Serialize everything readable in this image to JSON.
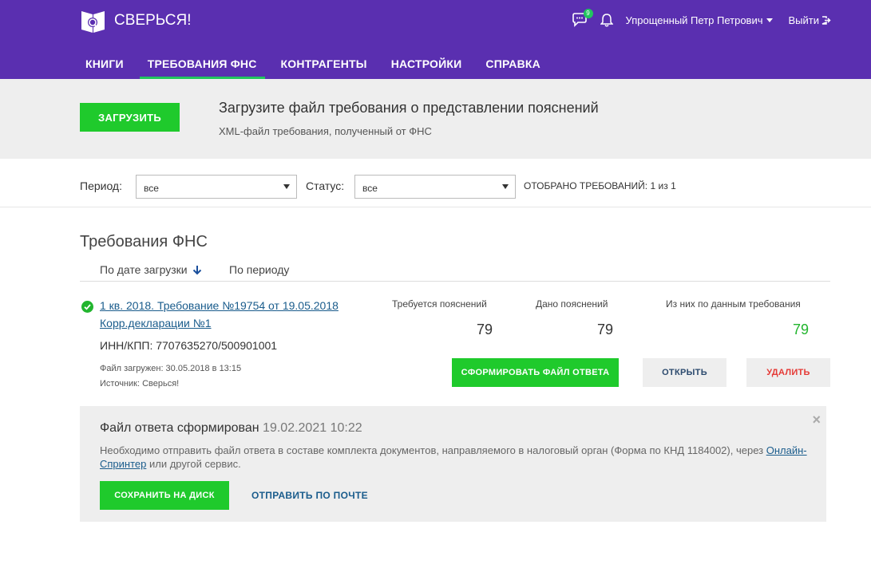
{
  "header": {
    "logo_text": "СВЕРЬСЯ!",
    "chat_badge": "9",
    "user_name": "Упрощенный Петр Петрович",
    "logout_label": "Выйти",
    "brand_color": "#5a2fb0"
  },
  "nav": {
    "items": [
      {
        "label": "КНИГИ",
        "active": false
      },
      {
        "label": "ТРЕБОВАНИЯ ФНС",
        "active": true
      },
      {
        "label": "КОНТРАГЕНТЫ",
        "active": false
      },
      {
        "label": "НАСТРОЙКИ",
        "active": false
      },
      {
        "label": "СПРАВКА",
        "active": false
      }
    ]
  },
  "upload": {
    "button_label": "ЗАГРУЗИТЬ",
    "title": "Загрузите файл требования о представлении пояснений",
    "subtitle": "XML-файл требования, полученный от ФНС"
  },
  "filters": {
    "period_label": "Период:",
    "period_value": "все",
    "status_label": "Статус:",
    "status_value": "все",
    "count_text": "ОТОБРАНО ТРЕБОВАНИЙ:",
    "count_value": "1",
    "count_of": "из",
    "count_total": "1"
  },
  "section": {
    "title": "Требования ФНС",
    "sort_by_date": "По дате загрузки",
    "sort_by_period": "По периоду"
  },
  "requirement": {
    "title_line1": "1 кв. 2018. Требование №19754 от 19.05.2018",
    "title_line2": "Корр.декларации №1",
    "inn_kpp": "ИНН/КПП: 7707635270/500901001",
    "uploaded": "Файл загружен: 30.05.2018 в 13:15",
    "source": "Источник: Сверься!",
    "stats": [
      {
        "label": "Требуется пояснений",
        "value": "79"
      },
      {
        "label": "Дано пояснений",
        "value": "79"
      },
      {
        "label": "Из них по данным требования",
        "value": "79"
      }
    ],
    "form_button": "СФОРМИРОВАТЬ ФАЙЛ ОТВЕТА",
    "open_button": "ОТКРЫТЬ",
    "delete_button": "УДАЛИТЬ"
  },
  "notice": {
    "title": "Файл ответа сформирован",
    "timestamp": "19.02.2021 10:22",
    "text_before": "Необходимо отправить файл ответа в составе комплекта документов, направляемого в налоговый орган (Форма по КНД 1184002), через",
    "link": "Онлайн-Спринтер",
    "text_after": "или другой сервис.",
    "close": "×",
    "save_button": "СОХРАНИТЬ НА ДИСК",
    "mail_link": "ОТПРАВИТЬ ПО ПОЧТЕ"
  }
}
